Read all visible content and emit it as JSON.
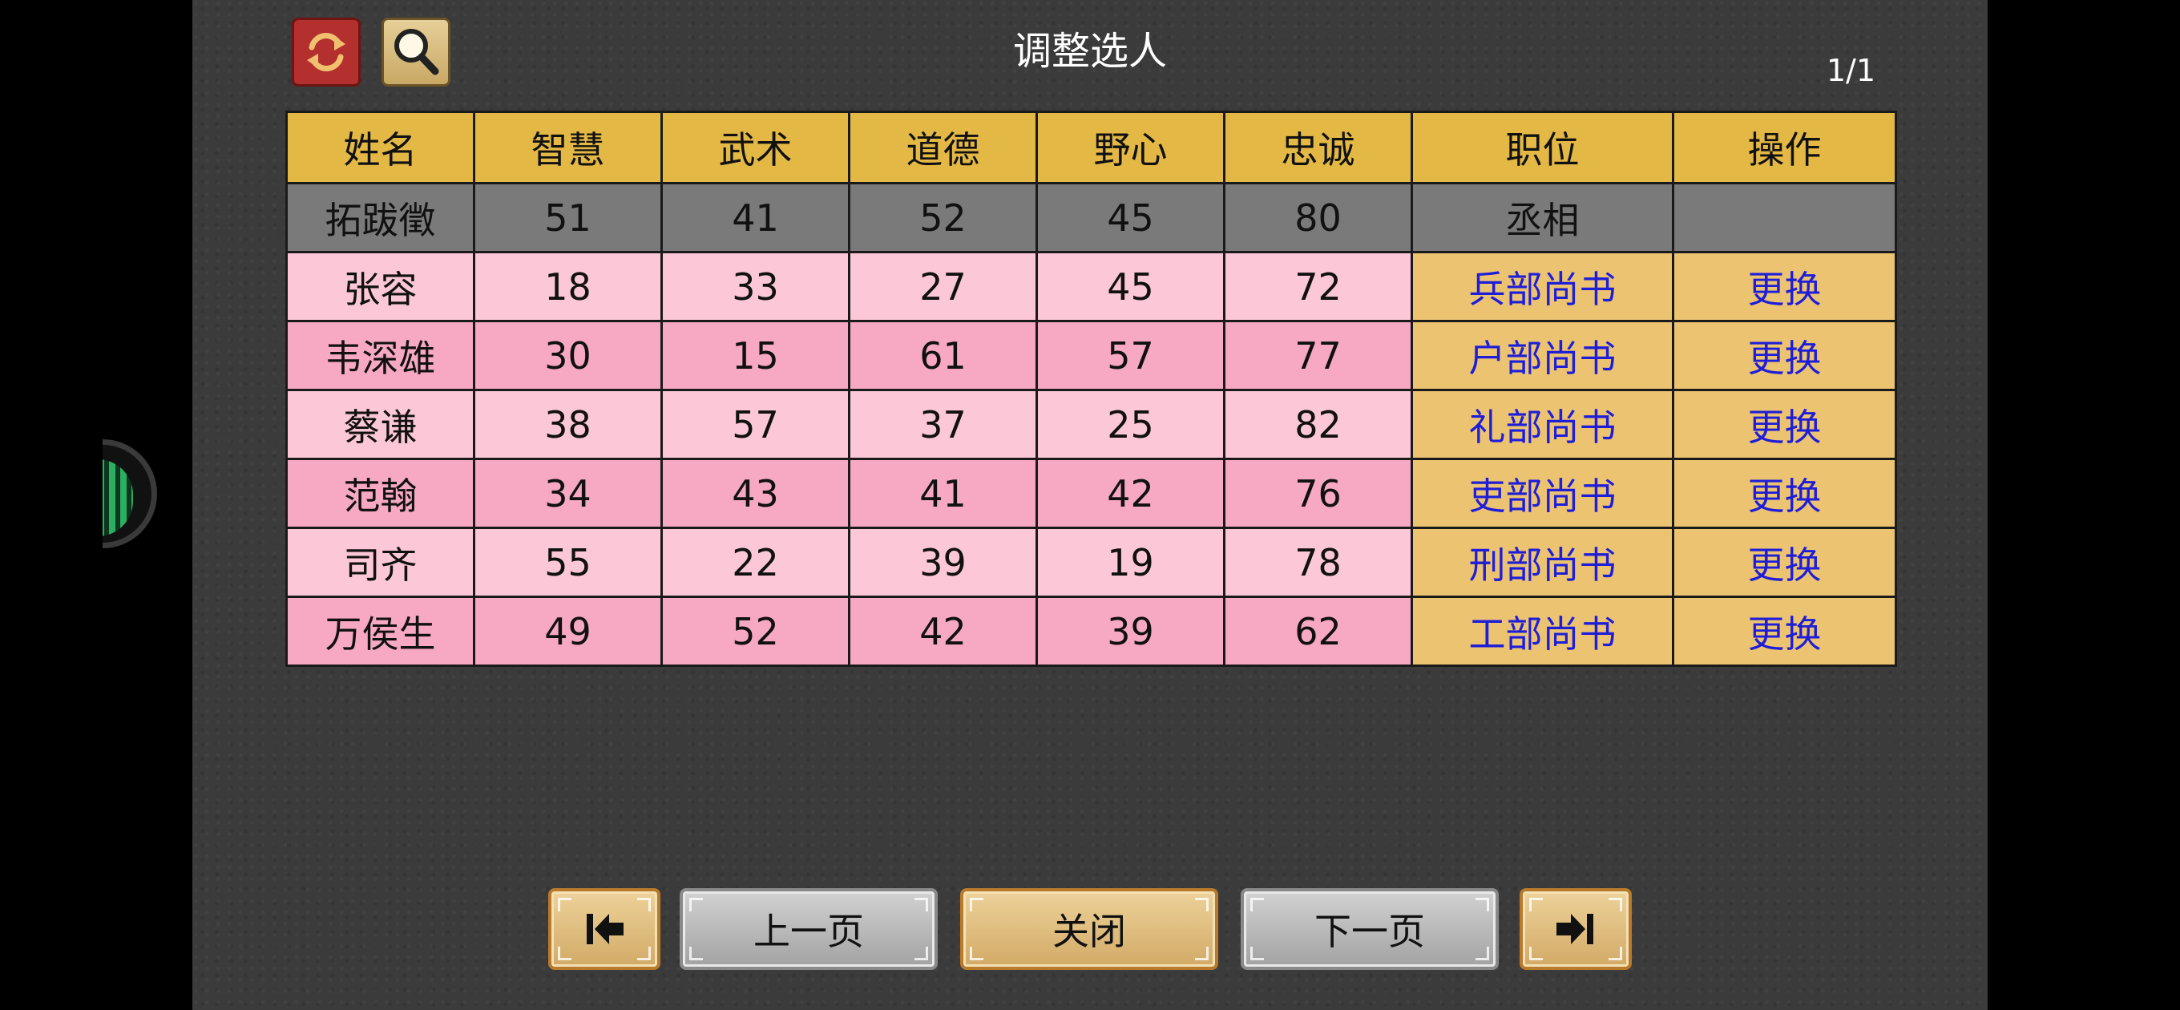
{
  "window": {
    "title": "调整选人",
    "page_indicator": "1/1"
  },
  "toolbar": {
    "refresh_icon": "refresh-icon",
    "search_icon": "magnifier-icon"
  },
  "table": {
    "headers": [
      "姓名",
      "智慧",
      "武术",
      "道德",
      "野心",
      "忠诚",
      "职位",
      "操作"
    ],
    "rows": [
      {
        "name": "拓跋徵",
        "wisdom": "51",
        "martial": "41",
        "morality": "52",
        "ambition": "45",
        "loyalty": "80",
        "post": "丞相",
        "action": ""
      },
      {
        "name": "张容",
        "wisdom": "18",
        "martial": "33",
        "morality": "27",
        "ambition": "45",
        "loyalty": "72",
        "post": "兵部尚书",
        "action": "更换"
      },
      {
        "name": "韦深雄",
        "wisdom": "30",
        "martial": "15",
        "morality": "61",
        "ambition": "57",
        "loyalty": "77",
        "post": "户部尚书",
        "action": "更换"
      },
      {
        "name": "蔡谦",
        "wisdom": "38",
        "martial": "57",
        "morality": "37",
        "ambition": "25",
        "loyalty": "82",
        "post": "礼部尚书",
        "action": "更换"
      },
      {
        "name": "范翰",
        "wisdom": "34",
        "martial": "43",
        "morality": "41",
        "ambition": "42",
        "loyalty": "76",
        "post": "吏部尚书",
        "action": "更换"
      },
      {
        "name": "司齐",
        "wisdom": "55",
        "martial": "22",
        "morality": "39",
        "ambition": "19",
        "loyalty": "78",
        "post": "刑部尚书",
        "action": "更换"
      },
      {
        "name": "万侯生",
        "wisdom": "49",
        "martial": "52",
        "morality": "42",
        "ambition": "39",
        "loyalty": "62",
        "post": "工部尚书",
        "action": "更换"
      }
    ]
  },
  "footer": {
    "first_icon": "first-page-arrow-icon",
    "prev_label": "上一页",
    "close_label": "关闭",
    "next_label": "下一页",
    "last_icon": "last-page-arrow-icon"
  },
  "colors": {
    "header_gold": "#e3b844",
    "row_light_pink": "#fcc8d8",
    "row_dark_pink": "#f7a8c3",
    "post_cell_gold": "#ecc371",
    "link_blue": "#1e1ed8",
    "highlight_grey": "#7a7a7a"
  }
}
